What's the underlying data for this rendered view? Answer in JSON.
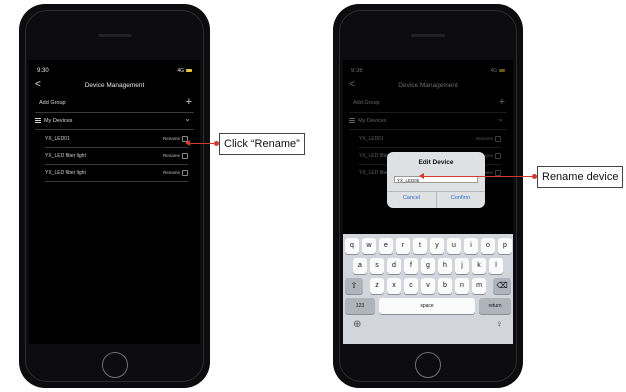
{
  "left_phone": {
    "status_time": "9:30",
    "status_icons": "4G",
    "nav_back": "<",
    "title": "Device Management",
    "add_group": "Add Group",
    "add_symbol": "+",
    "group_name": "My Devices",
    "group_chevron": "⌄",
    "devices": [
      {
        "name": "YX_LED01",
        "rename": "Rename"
      },
      {
        "name": "YX_LED fiber light",
        "rename": "Rename"
      },
      {
        "name": "YX_LED fiber light",
        "rename": "Rename"
      }
    ]
  },
  "right_phone": {
    "status_time": "9:36",
    "status_icons": "4G",
    "nav_back": "<",
    "title": "Device Management",
    "add_group": "Add Group",
    "add_symbol": "+",
    "group_name": "My Devices",
    "group_chevron": "⌄",
    "devices": [
      {
        "name": "YX_LED01",
        "rename": "Rename"
      },
      {
        "name": "YX_LED fiber light",
        "rename": "Rename"
      },
      {
        "name": "YX_LED fiber light",
        "rename": "Rename"
      }
    ],
    "dialog": {
      "title": "Edit Device",
      "value": "YX_LED05",
      "cancel": "Cancel",
      "confirm": "Confirm"
    },
    "keyboard": {
      "row1": [
        "q",
        "w",
        "e",
        "r",
        "t",
        "y",
        "u",
        "i",
        "o",
        "p"
      ],
      "row2": [
        "a",
        "s",
        "d",
        "f",
        "g",
        "h",
        "j",
        "k",
        "l"
      ],
      "row3": [
        "z",
        "x",
        "c",
        "v",
        "b",
        "n",
        "m"
      ],
      "shift": "⇧",
      "delete": "⌫",
      "numbers": "123",
      "space": "space",
      "return": "return",
      "globe": "⊕",
      "mic": "♀"
    }
  },
  "callouts": {
    "left": "Click “Rename”",
    "right": "Rename device"
  },
  "colors": {
    "arrow": "#d23b2b",
    "dialog_button": "#2f6fd1",
    "battery": "#e8c73d"
  }
}
